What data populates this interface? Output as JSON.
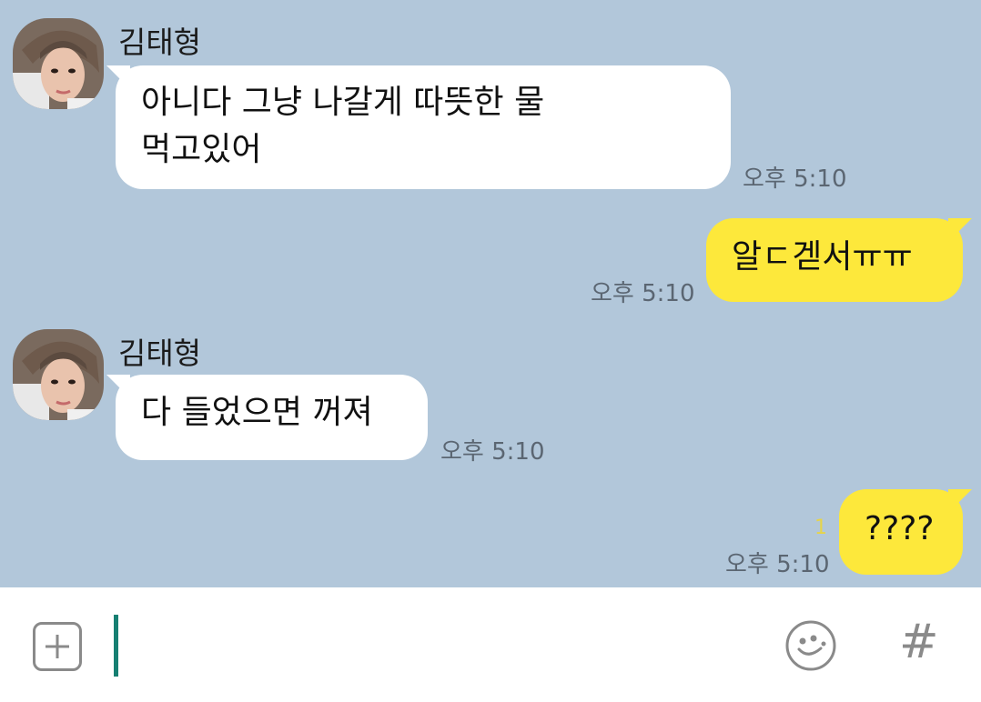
{
  "messages": [
    {
      "sender": "김태형",
      "text_line1": "아니다 그냥 나갈게 따뜻한 물",
      "text_line2": "먹고있어",
      "time": "오후 5:10"
    },
    {
      "text": "알ㄷ겓서ㅠㅠ",
      "time": "오후 5:10"
    },
    {
      "sender": "김태형",
      "text": "다 들었으면 꺼져",
      "time": "오후 5:10"
    },
    {
      "text": "????",
      "time": "오후 5:10",
      "unread": "1"
    }
  ],
  "icons": {
    "attach": "plus-square-icon",
    "emoji": "smiley-icon",
    "hash": "#"
  },
  "colors": {
    "background": "#b2c7da",
    "incoming_bubble": "#ffffff",
    "outgoing_bubble": "#fde83b",
    "caret": "#167f72"
  }
}
